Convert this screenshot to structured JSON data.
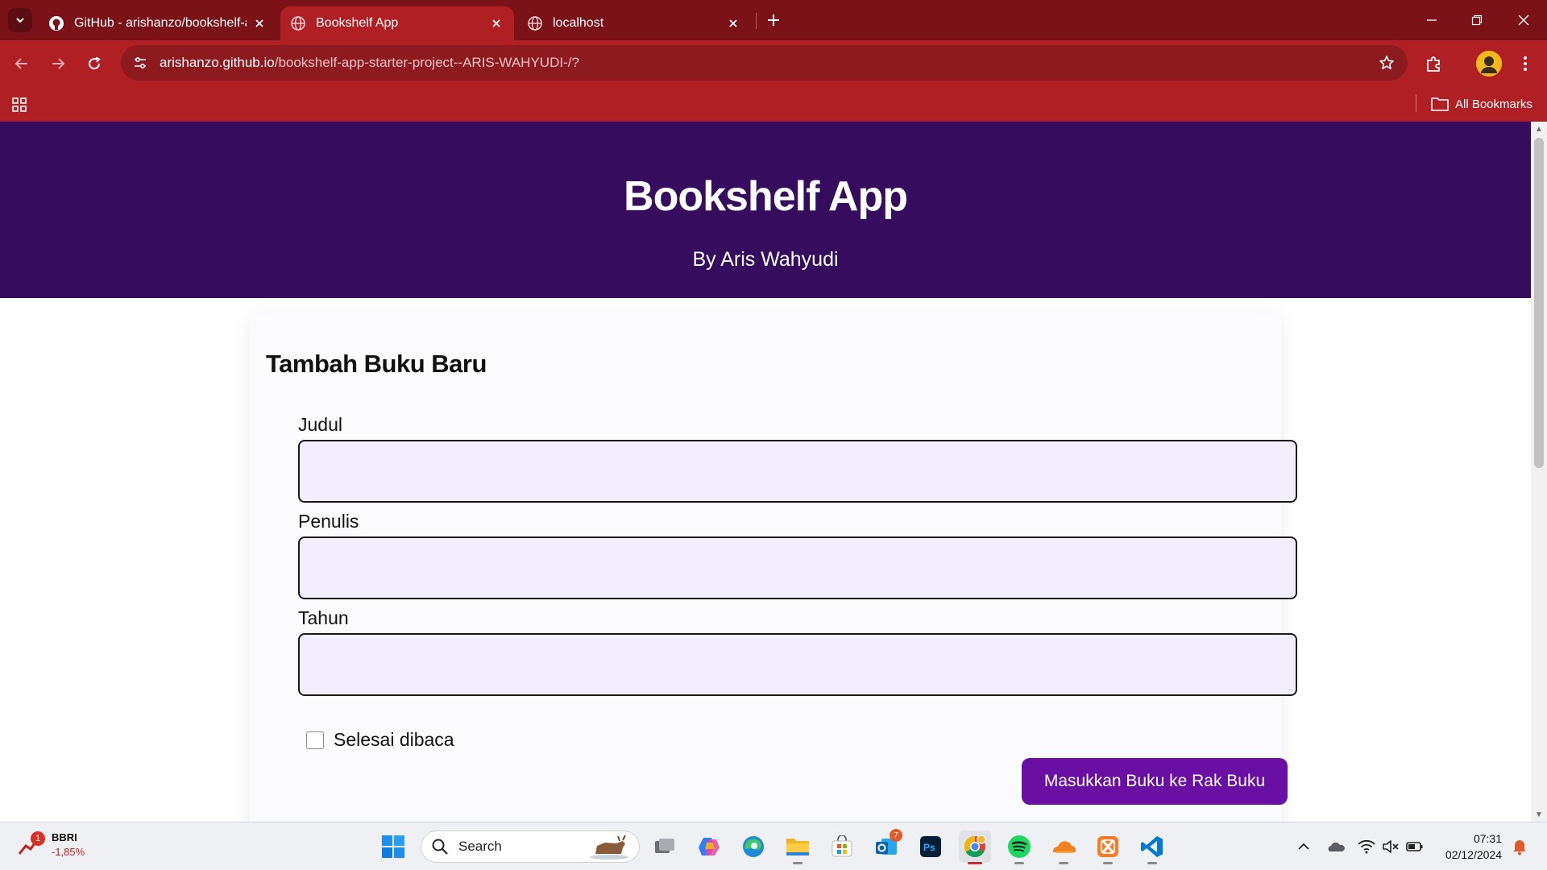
{
  "browser": {
    "tabs": [
      {
        "title": "GitHub - arishanzo/bookshelf-a",
        "icon": "github-icon",
        "active": false
      },
      {
        "title": "Bookshelf App",
        "icon": "globe-icon",
        "active": true
      },
      {
        "title": "localhost",
        "icon": "globe-icon",
        "active": false
      }
    ],
    "url_host": "arishanzo.github.io",
    "url_path": "/bookshelf-app-starter-project--ARIS-WAHYUDI-/?",
    "bookmarks_label": "All Bookmarks",
    "colors": {
      "tab_strip": "#7a1218",
      "toolbar": "#b01f24"
    }
  },
  "page": {
    "title": "Bookshelf App",
    "subtitle": "By Aris Wahyudi",
    "form": {
      "heading": "Tambah Buku Baru",
      "title_label": "Judul",
      "author_label": "Penulis",
      "year_label": "Tahun",
      "title_value": "",
      "author_value": "",
      "year_value": "",
      "complete_label": "Selesai dibaca",
      "complete_checked": false,
      "submit_label": "Masukkan Buku ke Rak Buku"
    },
    "colors": {
      "header": "#350c5e",
      "button": "#6a0fa3",
      "input_bg": "#f3eefe"
    }
  },
  "taskbar": {
    "stock_badge": "1",
    "stock_name": "BBRI",
    "stock_change": "-1,85%",
    "search_placeholder": "Search",
    "store_badge": "7",
    "time": "07:31",
    "date": "02/12/2024",
    "apps": [
      "task-view-icon",
      "copilot-icon",
      "edge-icon",
      "file-explorer-icon",
      "store-icon",
      "outlook-icon",
      "photoshop-icon",
      "chrome-icon",
      "spotify-icon",
      "cloudflare-icon",
      "xampp-icon",
      "vscode-icon"
    ]
  }
}
